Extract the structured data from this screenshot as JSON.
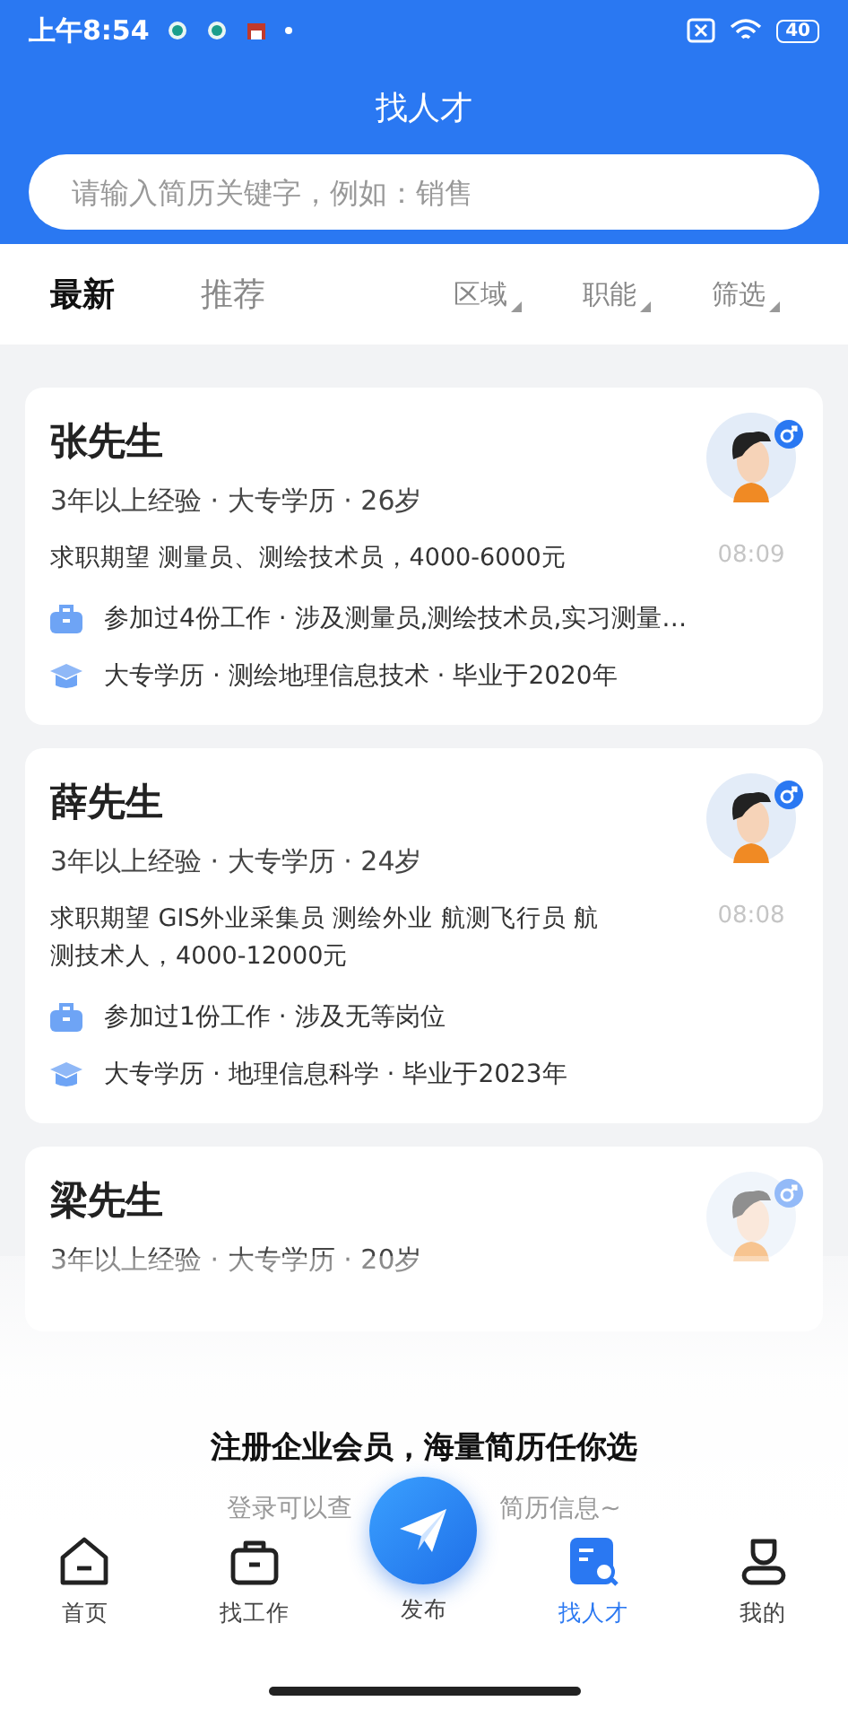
{
  "status_bar": {
    "time": "上午8:54",
    "battery": "40"
  },
  "header": {
    "title": "找人才"
  },
  "search": {
    "placeholder": "请输入简历关键字，例如：销售"
  },
  "sort_tabs": [
    {
      "label": "最新",
      "selected": true
    },
    {
      "label": "推荐",
      "selected": false
    }
  ],
  "filters": [
    {
      "label": "区域"
    },
    {
      "label": "职能"
    },
    {
      "label": "筛选"
    }
  ],
  "resumes": [
    {
      "name": "张先生",
      "summary": "3年以上经验 · 大专学历 · 26岁",
      "expectation": "求职期望 测量员、测绘技术员，4000-6000元",
      "time": "08:09",
      "work": "参加过4份工作 · 涉及测量员,测绘技术员,实习测量…",
      "education": "大专学历 · 测绘地理信息技术 · 毕业于2020年"
    },
    {
      "name": "薛先生",
      "summary": "3年以上经验 · 大专学历 · 24岁",
      "expectation": "求职期望 GIS外业采集员 测绘外业 航测飞行员 航测技术人，4000-12000元",
      "time": "08:08",
      "work": "参加过1份工作 · 涉及无等岗位",
      "education": "大专学历 · 地理信息科学 · 毕业于2023年"
    },
    {
      "name": "梁先生",
      "summary": "3年以上经验 · 大专学历 · 20岁"
    }
  ],
  "promo": {
    "title": "注册企业会员，海量简历任你选",
    "subtitle_left": "登录可以查",
    "subtitle_right": "简历信息~"
  },
  "tab_bar": [
    {
      "label": "首页",
      "kind": "home",
      "selected": false
    },
    {
      "label": "找工作",
      "kind": "jobs",
      "selected": false
    },
    {
      "label": "发布",
      "kind": "publish",
      "selected": false
    },
    {
      "label": "找人才",
      "kind": "talent",
      "selected": true
    },
    {
      "label": "我的",
      "kind": "me",
      "selected": false
    }
  ]
}
